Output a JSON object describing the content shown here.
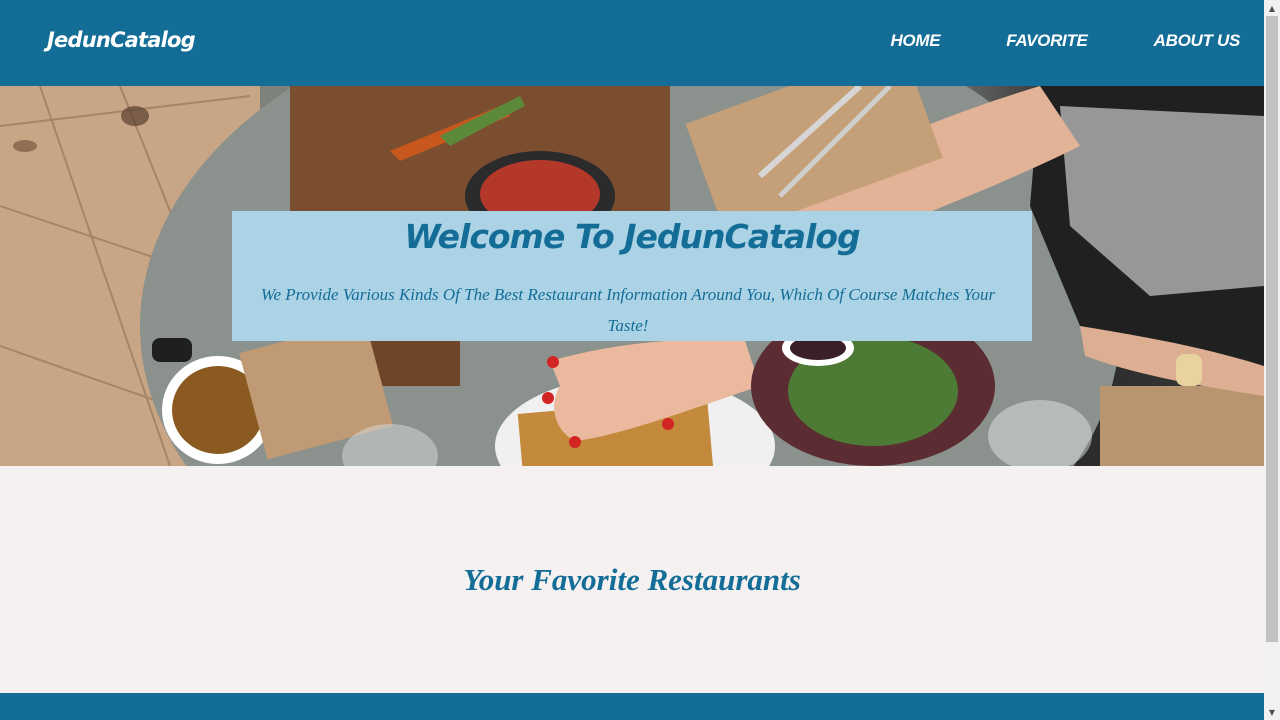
{
  "header": {
    "brand": "JedunCatalog",
    "nav": [
      {
        "label": "HOME"
      },
      {
        "label": "FAVORITE"
      },
      {
        "label": "ABOUT US"
      }
    ]
  },
  "hero": {
    "title": "Welcome To JedunCatalog",
    "subtitle": "We Provide Various Kinds Of The Best Restaurant Information Around You, Which Of Course Matches Your Taste!"
  },
  "favorites": {
    "heading": "Your Favorite Restaurants"
  },
  "colors": {
    "primary": "#136d97",
    "hero_box": "#abd2e5",
    "background": "#f5f1f1"
  },
  "icons": {
    "scroll_up": "triangle-up-icon",
    "scroll_down": "triangle-down-icon"
  }
}
